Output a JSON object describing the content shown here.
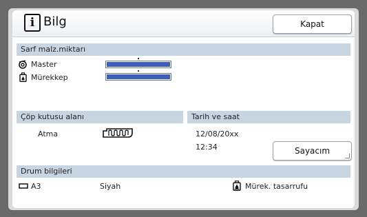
{
  "dialog": {
    "title": "Bilg",
    "info_icon_glyph": "i",
    "close_label": "Kapat"
  },
  "consumables": {
    "section_label": "Sarf malz.miktarı",
    "items": [
      {
        "label": "Master",
        "icon": "master-roll-icon",
        "level": 1.0
      },
      {
        "label": "Mürekkep",
        "icon": "ink-cartridge-icon",
        "level": 1.0
      }
    ]
  },
  "waste_box": {
    "section_label": "Çöp kutusu alanı",
    "label": "Atma",
    "icon": "waste-box-icon"
  },
  "datetime": {
    "section_label": "Tarih ve saat",
    "date": "12/08/20xx",
    "time": "12:34",
    "counter_label": "Sayacım"
  },
  "drum": {
    "section_label": "Drum bilgileri",
    "paper_size": "A3",
    "paper_icon": "paper-size-icon",
    "color": "Siyah",
    "ink_saving_label": "Mürek. tasarrufu",
    "ink_saving_icon": "ink-saving-icon"
  },
  "colors": {
    "accent_bar": "#3d5ebd",
    "section_header": "#c7d5e3",
    "background": "#6a6a6a"
  }
}
